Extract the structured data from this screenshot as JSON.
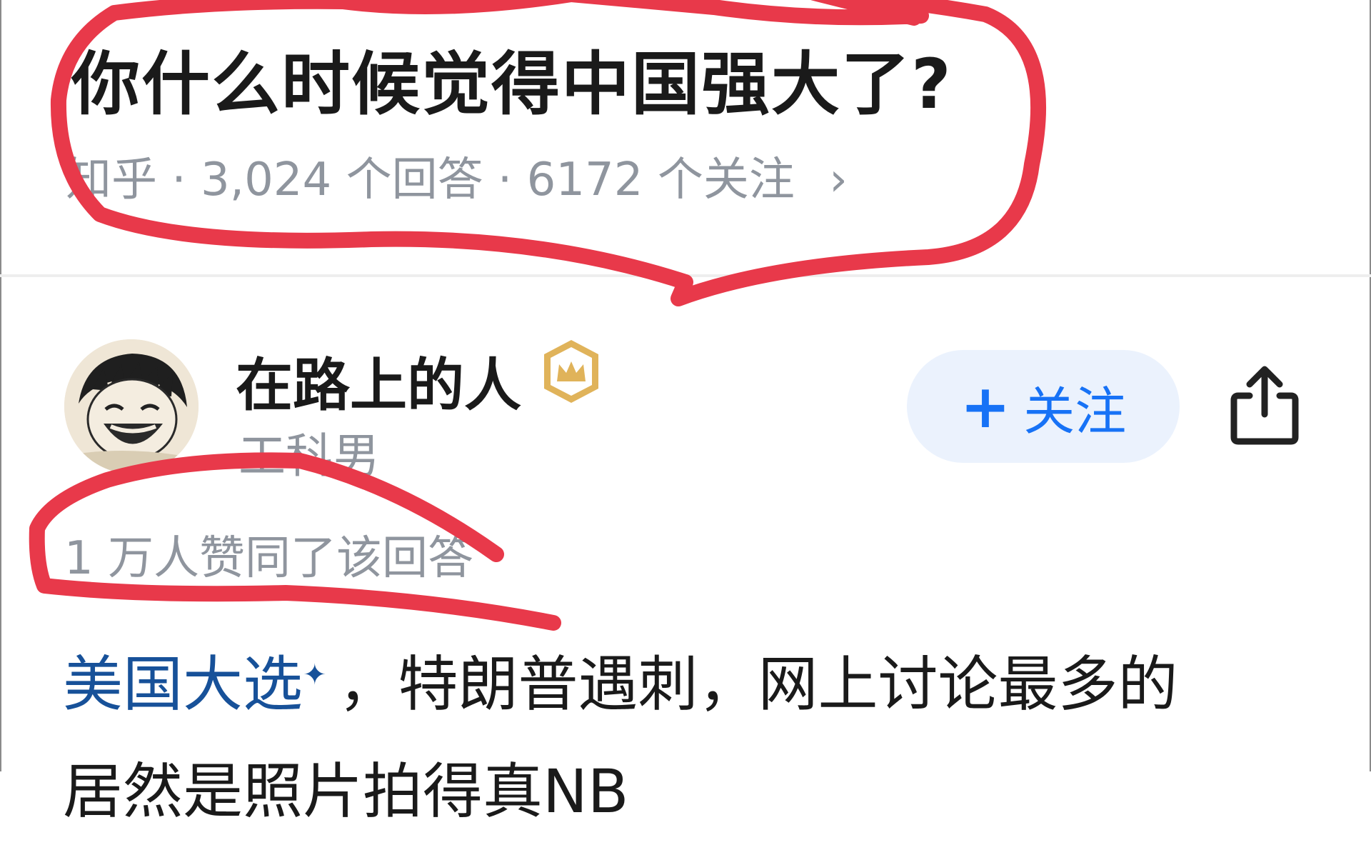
{
  "question": {
    "title": "你什么时候觉得中国强大了?",
    "meta": "知乎 · 3,024 个回答 · 6172 个关注",
    "chevron": "›"
  },
  "answer": {
    "author": {
      "name": "在路上的人",
      "tag": "工科男",
      "badge_icon": "crown-badge-icon"
    },
    "follow_button": {
      "plus": "+",
      "label": "关注"
    },
    "share_icon": "share-icon",
    "vote_text": "1 万人赞同了该回答",
    "content": {
      "topic_link": "美国大选",
      "topic_spark": "✦",
      "text_line_1": "，特朗普遇刺，网上讨论最多的",
      "text_line_2": "居然是照片拍得真NB"
    }
  },
  "colors": {
    "link_blue": "#175199",
    "follow_blue": "#1772f6",
    "follow_bg": "#ebf2fd",
    "meta_gray": "#8f959e",
    "annotation_red": "#e8394a",
    "badge_gold": "#e0b35a"
  }
}
